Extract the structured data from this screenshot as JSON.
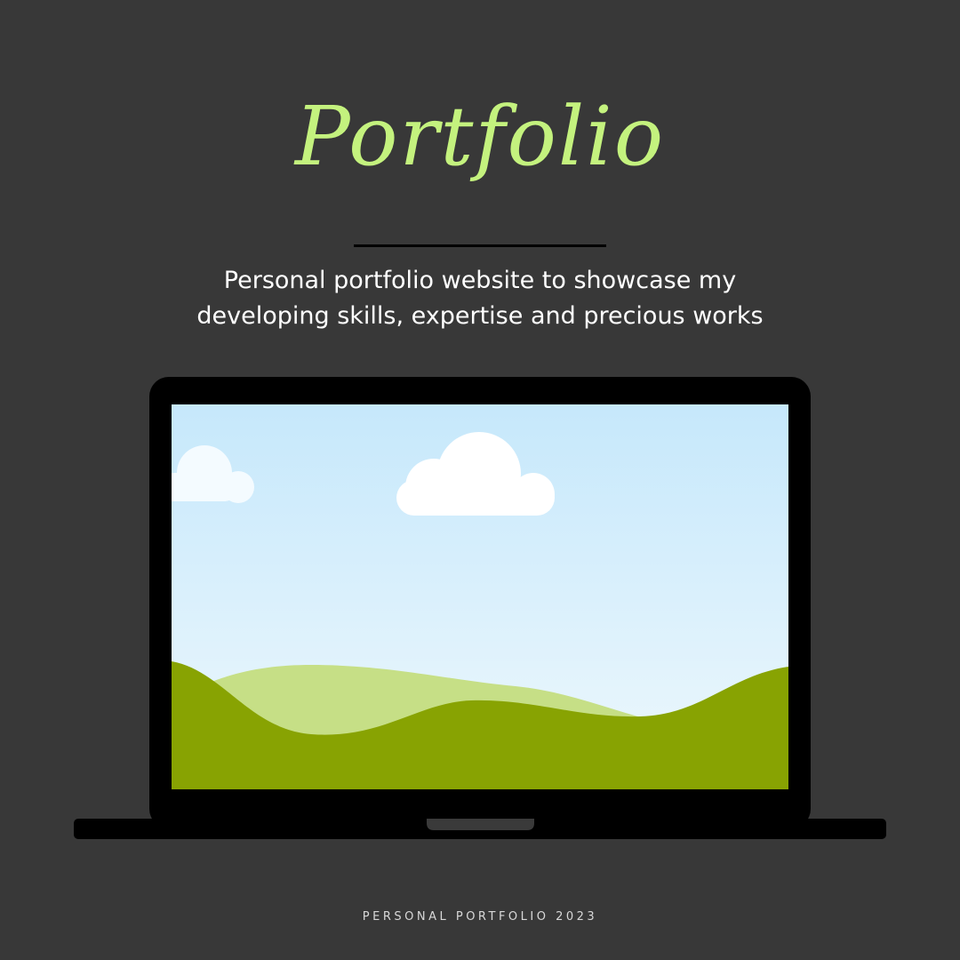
{
  "colors": {
    "background": "#383838",
    "title": "#c4f27e",
    "text": "#ffffff",
    "footer_text": "#d8d8d8",
    "laptop_body": "#000000",
    "sky_top": "#c6e8fb",
    "sky_bottom": "#eef8fd",
    "cloud": "#ffffff",
    "hill_light": "#c6df86",
    "hill_dark": "#88a302",
    "trackpad_notch": "#3a3a3a"
  },
  "header": {
    "title": "Portfolio",
    "description_line1": "Personal portfolio website to showcase my",
    "description_line2": "developing skills, expertise and precious works"
  },
  "footer": {
    "text": "PERSONAL PORTFOLIO 2023"
  },
  "illustration": {
    "device_icon": "laptop-icon",
    "scene": [
      "sky",
      "cloud-icon",
      "cloud-icon",
      "hill-icon",
      "hill-icon"
    ]
  }
}
